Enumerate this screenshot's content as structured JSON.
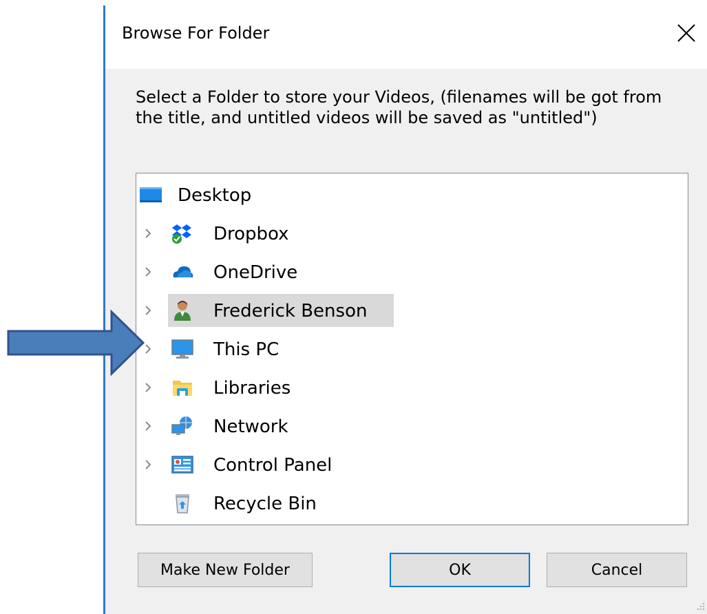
{
  "window": {
    "title": "Browse For Folder",
    "close_glyph": "✕"
  },
  "prompt": {
    "text": "Select a Folder to store your Videos, (filenames will be got from the title, and untitled videos will be saved as \"untitled\")"
  },
  "tree": {
    "root": {
      "label": "Desktop",
      "icon": "desktop-icon"
    },
    "items": [
      {
        "label": "Dropbox",
        "icon": "dropbox-icon",
        "expandable": true
      },
      {
        "label": "OneDrive",
        "icon": "onedrive-icon",
        "expandable": true
      },
      {
        "label": "Frederick Benson",
        "icon": "user-folder-icon",
        "expandable": true,
        "selected": true
      },
      {
        "label": "This PC",
        "icon": "this-pc-icon",
        "expandable": true
      },
      {
        "label": "Libraries",
        "icon": "libraries-icon",
        "expandable": true
      },
      {
        "label": "Network",
        "icon": "network-icon",
        "expandable": true
      },
      {
        "label": "Control Panel",
        "icon": "control-panel-icon",
        "expandable": true
      },
      {
        "label": "Recycle Bin",
        "icon": "recycle-bin-icon",
        "expandable": false
      }
    ]
  },
  "buttons": {
    "make_new_folder": "Make New Folder",
    "ok": "OK",
    "cancel": "Cancel"
  },
  "colors": {
    "accent": "#0078d7",
    "arrow_fill": "#4a7ebb",
    "arrow_stroke": "#2f528f",
    "selection": "#d9d9d9"
  }
}
